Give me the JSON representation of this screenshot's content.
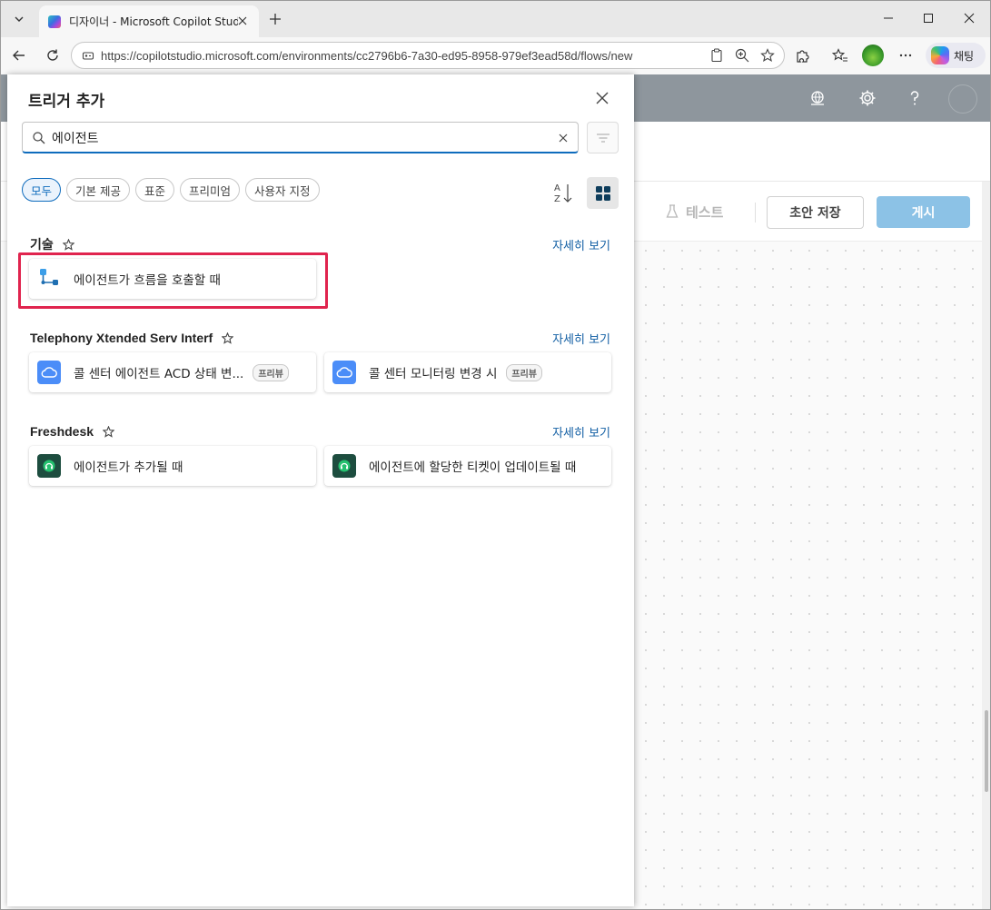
{
  "browser": {
    "tab_title": "디자이너 - Microsoft Copilot Studio",
    "url": "https://copilotstudio.microsoft.com/environments/cc2796b6-7a30-ed95-8958-979ef3ead58d/flows/new",
    "chat_label": "채팅"
  },
  "app": {
    "test_label": "테스트",
    "save_draft_label": "초안 저장",
    "publish_label": "게시"
  },
  "panel": {
    "title": "트리거 추가",
    "search_value": "에이전트",
    "filters": [
      "모두",
      "기본 제공",
      "표준",
      "프리미엄",
      "사용자 지정"
    ],
    "active_filter": "모두",
    "sections": [
      {
        "title": "기술",
        "more_label": "자세히 보기",
        "items": [
          {
            "label": "에이전트가 흐름을 호출할 때",
            "icon": "flow-icon",
            "badge": ""
          }
        ]
      },
      {
        "title": "Telephony Xtended Serv Interf",
        "more_label": "자세히 보기",
        "items": [
          {
            "label": "콜 센터 에이전트 ACD 상태 변...",
            "icon": "cloud-icon",
            "badge": "프리뷰"
          },
          {
            "label": "콜 센터 모니터링 변경 시",
            "icon": "cloud-icon",
            "badge": "프리뷰"
          }
        ]
      },
      {
        "title": "Freshdesk",
        "more_label": "자세히 보기",
        "items": [
          {
            "label": "에이전트가 추가될 때",
            "icon": "freshdesk-icon",
            "badge": ""
          },
          {
            "label": "에이전트에 할당한 티켓이 업데이트될 때",
            "icon": "freshdesk-icon",
            "badge": ""
          }
        ]
      }
    ]
  },
  "colors": {
    "accent": "#0f6cbd",
    "highlight_box": "#e0244e",
    "header_bar": "#8e969d",
    "publish_button": "#8cc2e6",
    "cloud_icon_bg": "#4b8df8",
    "freshdesk_icon_bg": "#1d4d3f"
  }
}
